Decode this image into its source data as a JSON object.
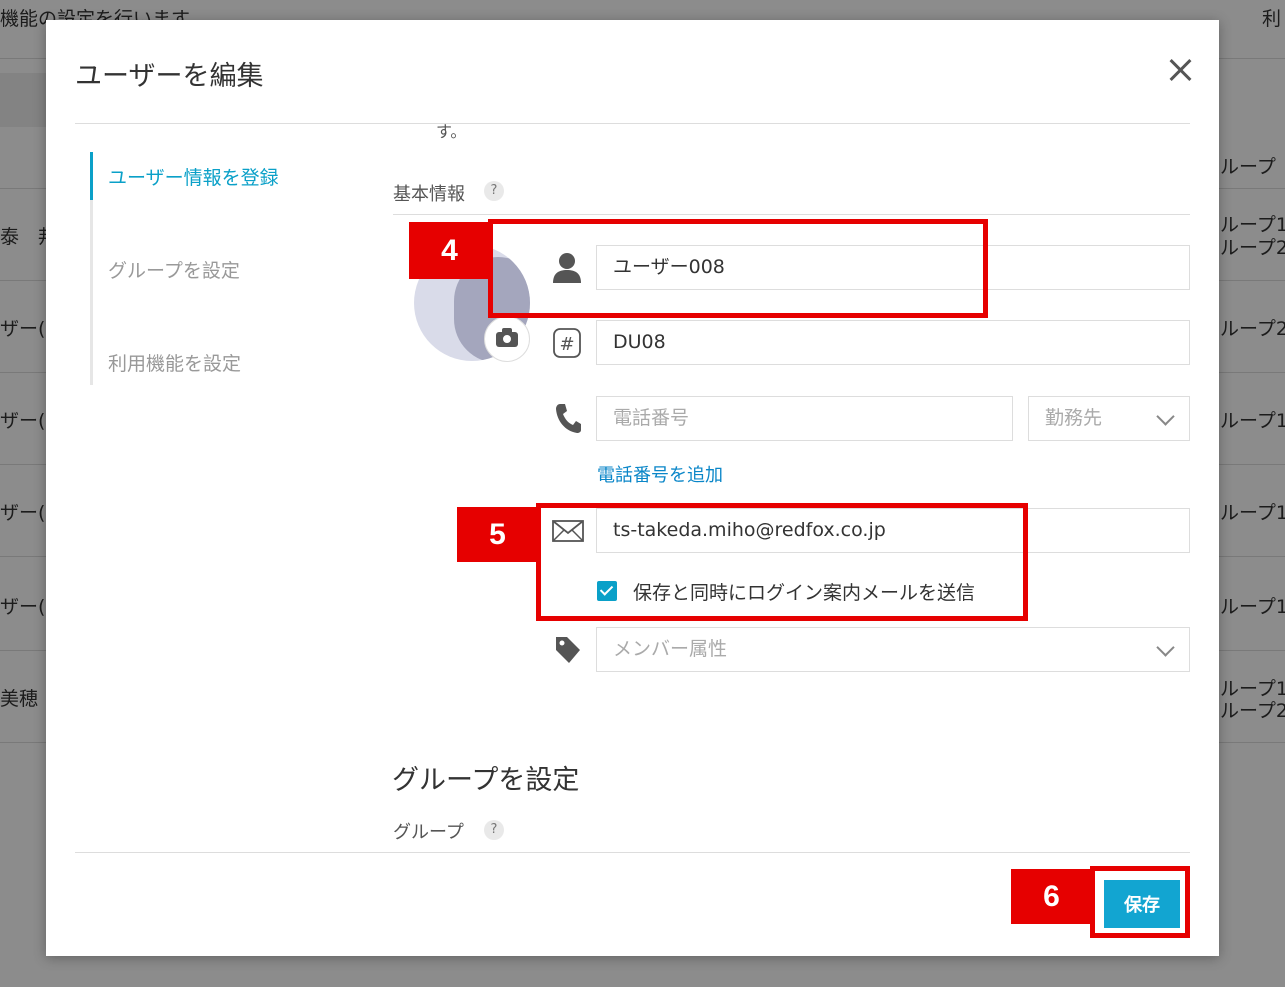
{
  "background": {
    "top_text": "機能の設定を行います",
    "top_right": "利",
    "col_group_header": "ループ",
    "rows_left": [
      "泰　邦",
      "ザー(",
      "ザー(",
      "ザー(",
      "ザー(",
      "美穂"
    ],
    "rows_right": [
      [
        "ループ1",
        "ループ2"
      ],
      [
        "ループ2"
      ],
      [
        "ループ1"
      ],
      [
        "ループ1"
      ],
      [
        "ループ1"
      ],
      [
        "ループ1",
        "ループ2"
      ]
    ]
  },
  "modal": {
    "title": "ユーザーを編集",
    "sidebar": {
      "items": [
        {
          "label": "ユーザー情報を登録"
        },
        {
          "label": "グループを設定"
        },
        {
          "label": "利用機能を設定"
        }
      ]
    },
    "scrolled_tail": "す。",
    "basic_info_label": "基本情報",
    "help_glyph": "?",
    "name_value": "ユーザー008",
    "code_value": "DU08",
    "phone_placeholder": "電話番号",
    "phone_type_placeholder": "勤務先",
    "add_phone_link": "電話番号を追加",
    "email_value": "ts-takeda.miho@redfox.co.jp",
    "send_mail_checkbox_label": "保存と同時にログイン案内メールを送信",
    "member_attr_placeholder": "メンバー属性",
    "group_section_heading": "グループを設定",
    "group_label": "グループ",
    "save_label": "保存"
  },
  "annotations": {
    "step4": "4",
    "step5": "5",
    "step6": "6",
    "color": "#e60000"
  },
  "icons": [
    "user-icon",
    "hash-icon",
    "phone-icon",
    "mail-icon",
    "tag-icon",
    "camera-icon",
    "close-icon",
    "chevron-down-icon"
  ],
  "colors": {
    "accent": "#0aa0c8",
    "save_button": "#12a5d1",
    "link": "#0a86c8"
  }
}
